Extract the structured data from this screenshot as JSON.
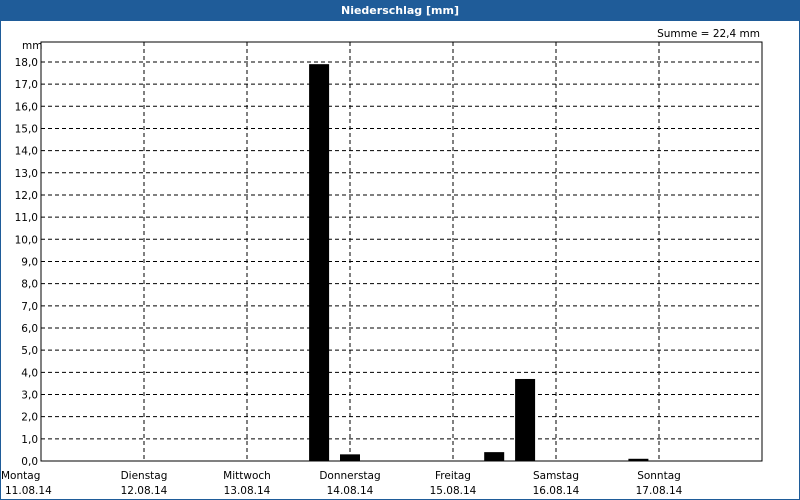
{
  "window": {
    "title": "Niederschlag [mm]"
  },
  "chart_data": {
    "type": "bar",
    "title": "Niederschlag [mm]",
    "summary": "Summe = 22,4 mm",
    "ylabel": "mm",
    "ylim": [
      0,
      18.9
    ],
    "yticks": [
      "0,0",
      "1,0",
      "2,0",
      "3,0",
      "4,0",
      "5,0",
      "6,0",
      "7,0",
      "8,0",
      "9,0",
      "10,0",
      "11,0",
      "12,0",
      "13,0",
      "14,0",
      "15,0",
      "16,0",
      "17,0",
      "18,0"
    ],
    "days": [
      {
        "name": "Montag",
        "date": "11.08.14"
      },
      {
        "name": "Dienstag",
        "date": "12.08.14"
      },
      {
        "name": "Mittwoch",
        "date": "13.08.14"
      },
      {
        "name": "Donnerstag",
        "date": "14.08.14"
      },
      {
        "name": "Freitag",
        "date": "15.08.14"
      },
      {
        "name": "Samstag",
        "date": "16.08.14"
      },
      {
        "name": "Sonntag",
        "date": "17.08.14"
      }
    ],
    "bars": [
      {
        "day": 2.7,
        "value": 17.9
      },
      {
        "day": 3.0,
        "value": 0.3
      },
      {
        "day": 4.4,
        "value": 0.4
      },
      {
        "day": 4.7,
        "value": 3.7
      },
      {
        "day": 5.8,
        "value": 0.1
      }
    ],
    "grid": true,
    "bar_color": "#000000",
    "grid_color": "#000000",
    "title_bar_color": "#1f5c99"
  }
}
